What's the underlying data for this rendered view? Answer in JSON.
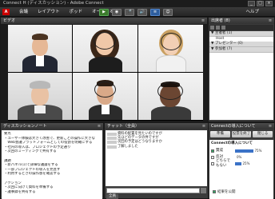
{
  "window": {
    "title": "Connect H (ディスカッション) - Adobe Connect",
    "min": "_",
    "max": "□",
    "close": "×"
  },
  "menubar": {
    "logo": "A",
    "menus": [
      "会議",
      "レイアウト",
      "ポッド",
      "オーディオ"
    ],
    "tools": [
      "▶",
      "◉",
      "🎤",
      "🔊",
      "≡",
      "☺"
    ],
    "help": "ヘルプ"
  },
  "video": {
    "title": "ビデオ",
    "menu": "≡"
  },
  "attendees": {
    "title": "出席者 (8)",
    "menu": "≡",
    "groups": [
      {
        "label": "▼ 主催者 (1)",
        "people": [
          "Host"
        ]
      },
      {
        "label": "▼ プレゼンター (0)",
        "people": []
      },
      {
        "label": "▼ 参加者 (7)",
        "people": []
      }
    ]
  },
  "notes": {
    "title": "ディスカッションノート",
    "menu": "≡",
    "lines": [
      "要点",
      "・ユーザー体験は大きく改善で、更新ごとの操作に大きな",
      "　Web会議プラットフォームとしての役割を明確にする",
      "・社内の導入は、プロジェクトの予定通り",
      "・次回のミーティングで共有する",
      "",
      "課題",
      "・新パネル(1)で詳細な議論をする",
      "・一部プロジェクトの導入を見直す",
      "・利用するときの操作感を確認する",
      "",
      "アクション",
      "・次回に向けて資料を準備する",
      "・議事録を共有する"
    ]
  },
  "chat": {
    "title": "チャット（全員）",
    "menu": "≡",
    "messages": [
      "資料の配置を見たいのですが",
      "先ほどのデータの件ですが",
      "次回の予定はどうなりますか",
      "了解しました"
    ],
    "tab": "全員"
  },
  "poll": {
    "title": "Connectの導入について",
    "menu": "≡",
    "buttons": [
      "準備",
      "投票を終了",
      "閉じる"
    ],
    "question": "Connectの導入について",
    "options": [
      {
        "label": "賛成",
        "percent": 75,
        "checked": true
      },
      {
        "label": "反対",
        "percent": 0,
        "checked": false
      },
      {
        "label": "どちらでもない",
        "percent": 25,
        "checked": false
      }
    ],
    "show_results_label": "結果を公開",
    "show_results_checked": true,
    "bar_color": "#3b72c7"
  }
}
